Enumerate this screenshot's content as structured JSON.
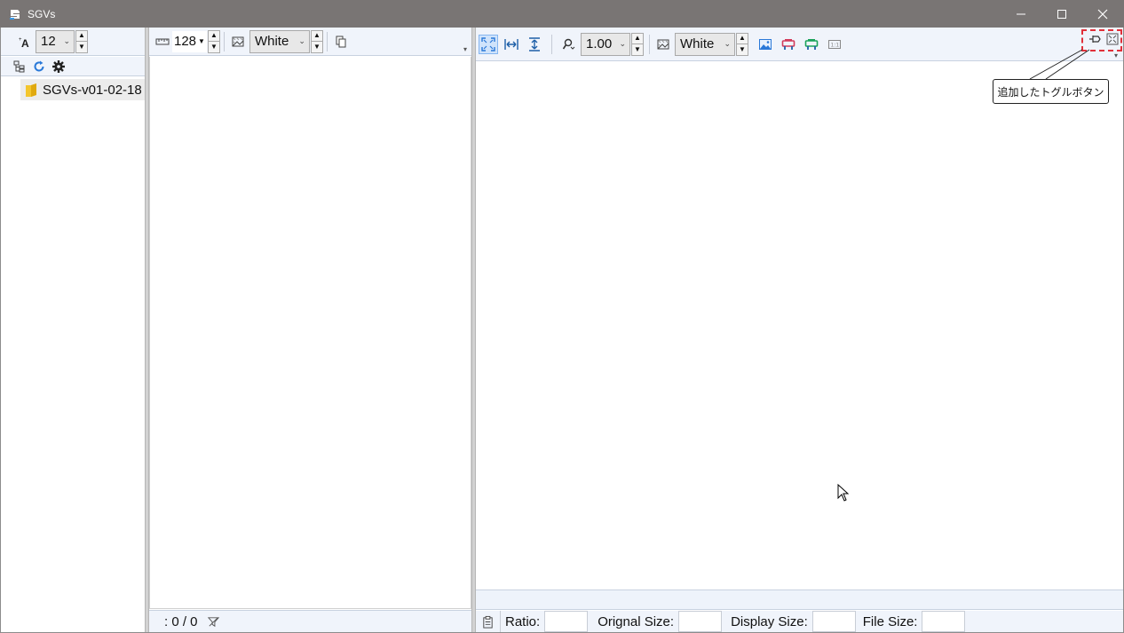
{
  "window": {
    "title": "SGVs"
  },
  "tree_panel": {
    "font_size_value": "12",
    "tree_items": [
      {
        "label": "SGVs-v01-02-18"
      }
    ]
  },
  "thumb_panel": {
    "thumb_size_value": "128",
    "background_value": "White",
    "status_text": ": 0 / 0"
  },
  "viewer_panel": {
    "zoom_value": "1.00",
    "background_value": "White",
    "status": {
      "ratio_label": "Ratio:",
      "original_size_label": "Orignal Size:",
      "display_size_label": "Display Size:",
      "file_size_label": "File Size:"
    }
  },
  "annotation": {
    "callout_text": "追加したトグルボタン",
    "highlight_color": "#e0303a"
  },
  "colors": {
    "titlebar": "#797574",
    "toolbar": "#f0f4fb",
    "accent_blue": "#2a79d8",
    "folder_yellow": "#f4c62e"
  }
}
